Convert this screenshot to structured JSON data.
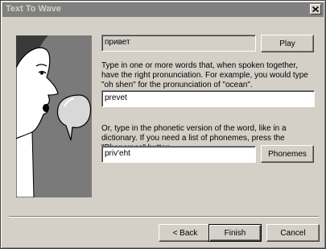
{
  "window": {
    "title": "Text To Wave",
    "close_icon": "close-icon"
  },
  "illustration": {
    "icon": "speaking-face-with-speech-balloon"
  },
  "word_display": {
    "value": "привет",
    "play_label": "Play"
  },
  "pronunciation": {
    "instructions": "Type in one or more words that, when spoken together, have the right pronunciation. For example, you would type \"oh shen\" for the pronunciation of \"ocean\".",
    "value": "prevet"
  },
  "phonetic": {
    "instructions": "Or, type in the phonetic version of the word, like in a dictionary. If you need a list of phonemes, press the \"Phonemes\" button.",
    "value": "priv'eht",
    "phonemes_label": "Phonemes"
  },
  "footer": {
    "back_label": "< Back",
    "finish_label": "Finish",
    "cancel_label": "Cancel"
  },
  "colors": {
    "dialog_bg": "#d4d0c8",
    "titlebar_bg": "#808080",
    "illustration_bg": "#7a7a7a"
  }
}
